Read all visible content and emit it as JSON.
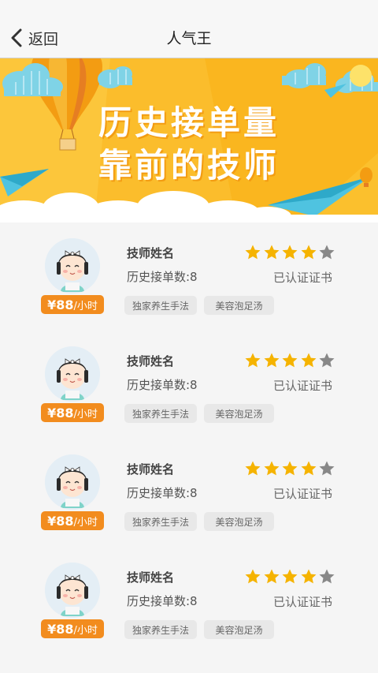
{
  "nav": {
    "back_label": "返回",
    "title": "人气王"
  },
  "banner": {
    "line1": "历史接单量",
    "line2": "靠前的技师"
  },
  "colors": {
    "accent": "#f28c1e",
    "star_on": "#f5b300",
    "star_off": "#888888",
    "banner_bg": "#fbc02d"
  },
  "technicians": [
    {
      "name": "技师姓名",
      "order_count": "历史接单数:8",
      "certificate": "已认证证书",
      "price": "¥88",
      "price_unit": "/小时",
      "rating": 4,
      "max_rating": 5,
      "tags": [
        "独家养生手法",
        "美容泡足汤"
      ]
    },
    {
      "name": "技师姓名",
      "order_count": "历史接单数:8",
      "certificate": "已认证证书",
      "price": "¥88",
      "price_unit": "/小时",
      "rating": 4,
      "max_rating": 5,
      "tags": [
        "独家养生手法",
        "美容泡足汤"
      ]
    },
    {
      "name": "技师姓名",
      "order_count": "历史接单数:8",
      "certificate": "已认证证书",
      "price": "¥88",
      "price_unit": "/小时",
      "rating": 4,
      "max_rating": 5,
      "tags": [
        "独家养生手法",
        "美容泡足汤"
      ]
    },
    {
      "name": "技师姓名",
      "order_count": "历史接单数:8",
      "certificate": "已认证证书",
      "price": "¥88",
      "price_unit": "/小时",
      "rating": 4,
      "max_rating": 5,
      "tags": [
        "独家养生手法",
        "美容泡足汤"
      ]
    }
  ]
}
